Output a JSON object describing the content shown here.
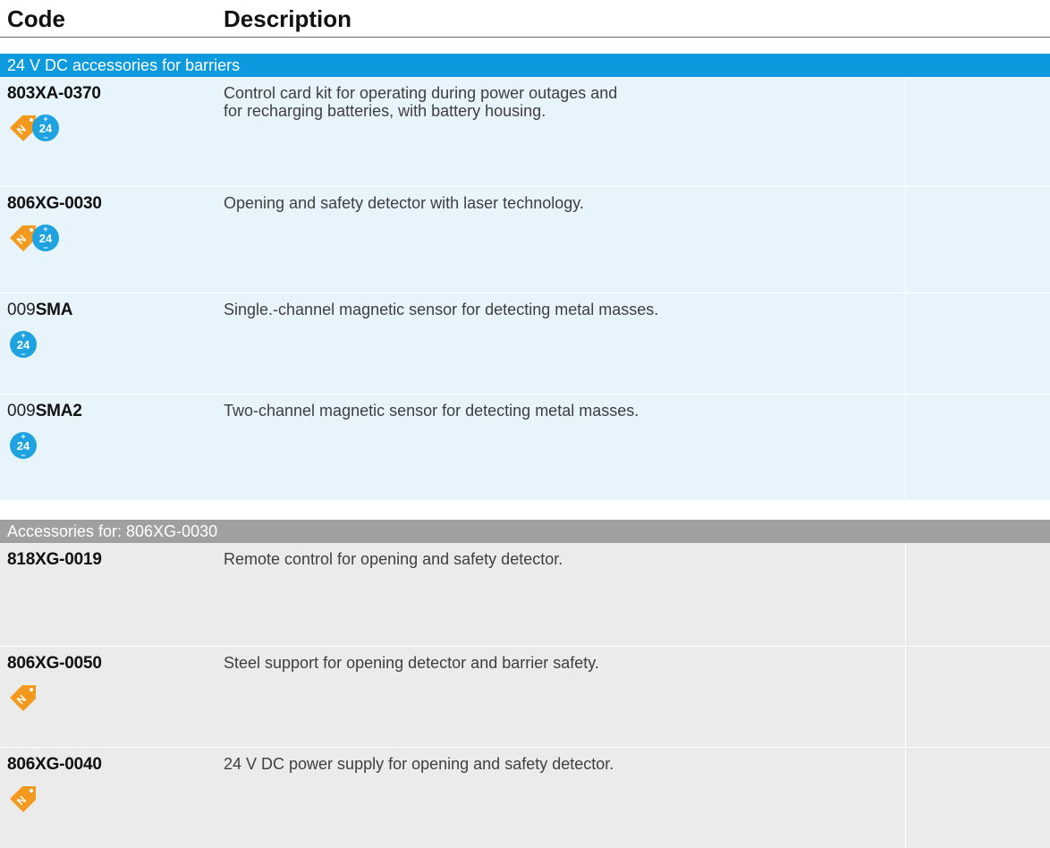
{
  "header": {
    "code_label": "Code",
    "description_label": "Description"
  },
  "sections": [
    {
      "title": "24 V DC accessories for barriers",
      "rows": [
        {
          "code_prefix": "",
          "code_bold": "803XA-0370",
          "desc": [
            "Control card kit for operating during power outages and",
            "for recharging batteries, with battery housing."
          ],
          "icons": [
            "new-tag-icon",
            "24v-icon"
          ]
        },
        {
          "code_prefix": "",
          "code_bold": "806XG-0030",
          "desc": [
            "Opening and safety detector with laser technology."
          ],
          "icons": [
            "new-tag-icon",
            "24v-icon"
          ]
        },
        {
          "code_prefix": "009",
          "code_bold": "SMA",
          "desc": [
            "Single.-channel magnetic sensor for detecting metal masses."
          ],
          "icons": [
            "24v-icon"
          ]
        },
        {
          "code_prefix": "009",
          "code_bold": "SMA2",
          "desc": [
            "Two-channel magnetic sensor for detecting metal masses."
          ],
          "icons": [
            "24v-icon"
          ]
        }
      ]
    },
    {
      "title": "Accessories for: 806XG-0030",
      "rows": [
        {
          "code_prefix": "",
          "code_bold": "818XG-0019",
          "desc": [
            "Remote control for opening and safety detector."
          ],
          "icons": []
        },
        {
          "code_prefix": "",
          "code_bold": "806XG-0050",
          "desc": [
            "Steel support for opening detector and barrier safety."
          ],
          "icons": [
            "new-tag-icon"
          ]
        },
        {
          "code_prefix": "",
          "code_bold": "806XG-0040",
          "desc": [
            "24 V DC power supply for opening and safety detector."
          ],
          "icons": [
            "new-tag-icon"
          ]
        }
      ]
    }
  ],
  "icon_text": {
    "new": "N",
    "volt": "24",
    "plus": "+",
    "minus": "−"
  },
  "colors": {
    "blue_header": "#0d99dd",
    "blue_row": "#e7f4fc",
    "gray_header": "#a0a0a0",
    "gray_row": "#ebebeb",
    "new_tag": "#f39a1e",
    "volt_badge": "#1ea3e0"
  }
}
